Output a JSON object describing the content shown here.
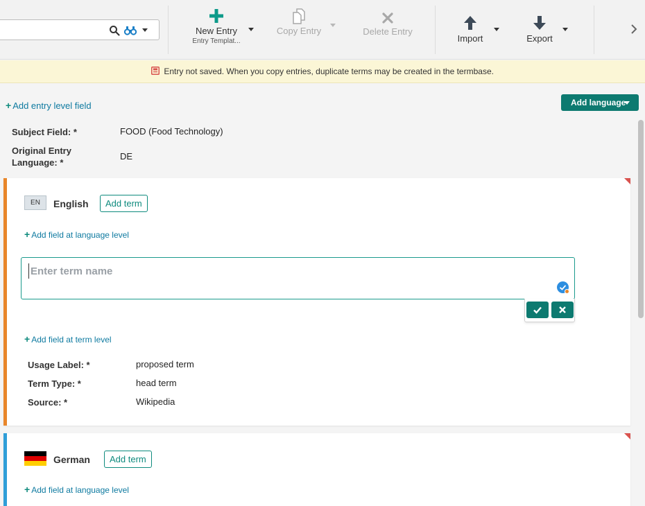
{
  "toolbar": {
    "search": {
      "value": "",
      "placeholder": ""
    },
    "new_entry": {
      "label": "New Entry",
      "sublabel": "Entry Templat..."
    },
    "copy_entry": {
      "label": "Copy Entry"
    },
    "delete_entry": {
      "label": "Delete Entry"
    },
    "import": {
      "label": "Import"
    },
    "export": {
      "label": "Export"
    }
  },
  "banner": {
    "message": "Entry not saved. When you copy entries, duplicate terms may be created in the termbase."
  },
  "entry": {
    "add_entry_field": "Add entry level field",
    "add_language": "Add language",
    "fields": [
      {
        "label": "Subject Field: *",
        "value": "FOOD (Food Technology)"
      },
      {
        "label": "Original Entry Language: *",
        "value": "DE"
      }
    ]
  },
  "english": {
    "code": "EN",
    "name": "English",
    "add_term": "Add term",
    "add_language_field": "Add field at language level",
    "term_input": {
      "value": "",
      "placeholder": "Enter term name"
    },
    "add_term_field": "Add field at term level",
    "term_fields": [
      {
        "label": "Usage Label: *",
        "value": "proposed term"
      },
      {
        "label": "Term Type: *",
        "value": "head term"
      },
      {
        "label": "Source: *",
        "value": "Wikipedia"
      }
    ]
  },
  "german": {
    "name": "German",
    "add_term": "Add term",
    "add_language_field": "Add field at language level"
  },
  "colors": {
    "accent": "#0d7a70",
    "link": "#0e7aa0",
    "english_bar": "#e8862a",
    "german_bar": "#2f9ed8",
    "banner_bg": "#fbf6d6",
    "warning": "#d9534f"
  },
  "icons": [
    "search-icon",
    "binoculars-icon",
    "plus-icon",
    "copy-icon",
    "x-icon",
    "arrow-up-icon",
    "arrow-down-icon",
    "chevron-right-icon",
    "warning-icon",
    "spellcheck-icon",
    "check-icon",
    "close-icon",
    "german-flag-icon"
  ]
}
